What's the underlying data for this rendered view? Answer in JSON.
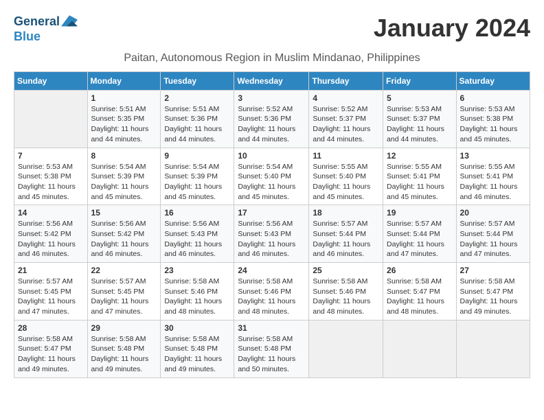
{
  "logo": {
    "line1": "General",
    "line2": "Blue"
  },
  "title": "January 2024",
  "location": "Paitan, Autonomous Region in Muslim Mindanao, Philippines",
  "headers": [
    "Sunday",
    "Monday",
    "Tuesday",
    "Wednesday",
    "Thursday",
    "Friday",
    "Saturday"
  ],
  "weeks": [
    [
      {
        "day": "",
        "sunrise": "",
        "sunset": "",
        "daylight": ""
      },
      {
        "day": "1",
        "sunrise": "Sunrise: 5:51 AM",
        "sunset": "Sunset: 5:35 PM",
        "daylight": "Daylight: 11 hours and 44 minutes."
      },
      {
        "day": "2",
        "sunrise": "Sunrise: 5:51 AM",
        "sunset": "Sunset: 5:36 PM",
        "daylight": "Daylight: 11 hours and 44 minutes."
      },
      {
        "day": "3",
        "sunrise": "Sunrise: 5:52 AM",
        "sunset": "Sunset: 5:36 PM",
        "daylight": "Daylight: 11 hours and 44 minutes."
      },
      {
        "day": "4",
        "sunrise": "Sunrise: 5:52 AM",
        "sunset": "Sunset: 5:37 PM",
        "daylight": "Daylight: 11 hours and 44 minutes."
      },
      {
        "day": "5",
        "sunrise": "Sunrise: 5:53 AM",
        "sunset": "Sunset: 5:37 PM",
        "daylight": "Daylight: 11 hours and 44 minutes."
      },
      {
        "day": "6",
        "sunrise": "Sunrise: 5:53 AM",
        "sunset": "Sunset: 5:38 PM",
        "daylight": "Daylight: 11 hours and 45 minutes."
      }
    ],
    [
      {
        "day": "7",
        "sunrise": "Sunrise: 5:53 AM",
        "sunset": "Sunset: 5:38 PM",
        "daylight": "Daylight: 11 hours and 45 minutes."
      },
      {
        "day": "8",
        "sunrise": "Sunrise: 5:54 AM",
        "sunset": "Sunset: 5:39 PM",
        "daylight": "Daylight: 11 hours and 45 minutes."
      },
      {
        "day": "9",
        "sunrise": "Sunrise: 5:54 AM",
        "sunset": "Sunset: 5:39 PM",
        "daylight": "Daylight: 11 hours and 45 minutes."
      },
      {
        "day": "10",
        "sunrise": "Sunrise: 5:54 AM",
        "sunset": "Sunset: 5:40 PM",
        "daylight": "Daylight: 11 hours and 45 minutes."
      },
      {
        "day": "11",
        "sunrise": "Sunrise: 5:55 AM",
        "sunset": "Sunset: 5:40 PM",
        "daylight": "Daylight: 11 hours and 45 minutes."
      },
      {
        "day": "12",
        "sunrise": "Sunrise: 5:55 AM",
        "sunset": "Sunset: 5:41 PM",
        "daylight": "Daylight: 11 hours and 45 minutes."
      },
      {
        "day": "13",
        "sunrise": "Sunrise: 5:55 AM",
        "sunset": "Sunset: 5:41 PM",
        "daylight": "Daylight: 11 hours and 46 minutes."
      }
    ],
    [
      {
        "day": "14",
        "sunrise": "Sunrise: 5:56 AM",
        "sunset": "Sunset: 5:42 PM",
        "daylight": "Daylight: 11 hours and 46 minutes."
      },
      {
        "day": "15",
        "sunrise": "Sunrise: 5:56 AM",
        "sunset": "Sunset: 5:42 PM",
        "daylight": "Daylight: 11 hours and 46 minutes."
      },
      {
        "day": "16",
        "sunrise": "Sunrise: 5:56 AM",
        "sunset": "Sunset: 5:43 PM",
        "daylight": "Daylight: 11 hours and 46 minutes."
      },
      {
        "day": "17",
        "sunrise": "Sunrise: 5:56 AM",
        "sunset": "Sunset: 5:43 PM",
        "daylight": "Daylight: 11 hours and 46 minutes."
      },
      {
        "day": "18",
        "sunrise": "Sunrise: 5:57 AM",
        "sunset": "Sunset: 5:44 PM",
        "daylight": "Daylight: 11 hours and 46 minutes."
      },
      {
        "day": "19",
        "sunrise": "Sunrise: 5:57 AM",
        "sunset": "Sunset: 5:44 PM",
        "daylight": "Daylight: 11 hours and 47 minutes."
      },
      {
        "day": "20",
        "sunrise": "Sunrise: 5:57 AM",
        "sunset": "Sunset: 5:44 PM",
        "daylight": "Daylight: 11 hours and 47 minutes."
      }
    ],
    [
      {
        "day": "21",
        "sunrise": "Sunrise: 5:57 AM",
        "sunset": "Sunset: 5:45 PM",
        "daylight": "Daylight: 11 hours and 47 minutes."
      },
      {
        "day": "22",
        "sunrise": "Sunrise: 5:57 AM",
        "sunset": "Sunset: 5:45 PM",
        "daylight": "Daylight: 11 hours and 47 minutes."
      },
      {
        "day": "23",
        "sunrise": "Sunrise: 5:58 AM",
        "sunset": "Sunset: 5:46 PM",
        "daylight": "Daylight: 11 hours and 48 minutes."
      },
      {
        "day": "24",
        "sunrise": "Sunrise: 5:58 AM",
        "sunset": "Sunset: 5:46 PM",
        "daylight": "Daylight: 11 hours and 48 minutes."
      },
      {
        "day": "25",
        "sunrise": "Sunrise: 5:58 AM",
        "sunset": "Sunset: 5:46 PM",
        "daylight": "Daylight: 11 hours and 48 minutes."
      },
      {
        "day": "26",
        "sunrise": "Sunrise: 5:58 AM",
        "sunset": "Sunset: 5:47 PM",
        "daylight": "Daylight: 11 hours and 48 minutes."
      },
      {
        "day": "27",
        "sunrise": "Sunrise: 5:58 AM",
        "sunset": "Sunset: 5:47 PM",
        "daylight": "Daylight: 11 hours and 49 minutes."
      }
    ],
    [
      {
        "day": "28",
        "sunrise": "Sunrise: 5:58 AM",
        "sunset": "Sunset: 5:47 PM",
        "daylight": "Daylight: 11 hours and 49 minutes."
      },
      {
        "day": "29",
        "sunrise": "Sunrise: 5:58 AM",
        "sunset": "Sunset: 5:48 PM",
        "daylight": "Daylight: 11 hours and 49 minutes."
      },
      {
        "day": "30",
        "sunrise": "Sunrise: 5:58 AM",
        "sunset": "Sunset: 5:48 PM",
        "daylight": "Daylight: 11 hours and 49 minutes."
      },
      {
        "day": "31",
        "sunrise": "Sunrise: 5:58 AM",
        "sunset": "Sunset: 5:48 PM",
        "daylight": "Daylight: 11 hours and 50 minutes."
      },
      {
        "day": "",
        "sunrise": "",
        "sunset": "",
        "daylight": ""
      },
      {
        "day": "",
        "sunrise": "",
        "sunset": "",
        "daylight": ""
      },
      {
        "day": "",
        "sunrise": "",
        "sunset": "",
        "daylight": ""
      }
    ]
  ]
}
